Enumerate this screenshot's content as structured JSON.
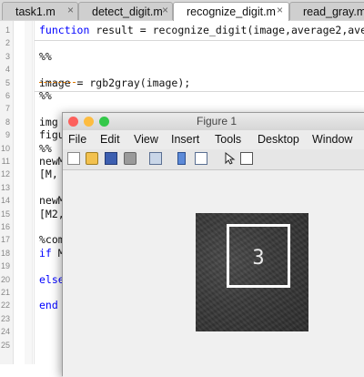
{
  "tabs": [
    {
      "label": "task1.m",
      "active": false
    },
    {
      "label": "detect_digit.m",
      "active": false
    },
    {
      "label": "recognize_digit.m",
      "active": true
    },
    {
      "label": "read_gray.m",
      "active": false
    }
  ],
  "tab_close_glyph": "×",
  "editor": {
    "lines": [
      {
        "num": "1",
        "code": "function result = recognize_digit(image,average2,avera"
      },
      {
        "num": "2",
        "code": ""
      },
      {
        "num": "3",
        "code": "%%"
      },
      {
        "num": "4",
        "code": ""
      },
      {
        "num": "5",
        "code": "image = rgb2gray(image);"
      },
      {
        "num": "6",
        "code": "%%"
      },
      {
        "num": "7",
        "code": ""
      },
      {
        "num": "8",
        "code": "img"
      },
      {
        "num": "9",
        "code": "figu"
      },
      {
        "num": "10",
        "code": "%%"
      },
      {
        "num": "11",
        "code": "newM"
      },
      {
        "num": "12",
        "code": "[M,"
      },
      {
        "num": "13",
        "code": ""
      },
      {
        "num": "14",
        "code": "newM"
      },
      {
        "num": "15",
        "code": "[M2,"
      },
      {
        "num": "16",
        "code": ""
      },
      {
        "num": "17",
        "code": "%com"
      },
      {
        "num": "18",
        "code": "if M"
      },
      {
        "num": "19",
        "code": ""
      },
      {
        "num": "20",
        "code": "else"
      },
      {
        "num": "21",
        "code": ""
      },
      {
        "num": "22",
        "code": "end"
      },
      {
        "num": "23",
        "code": ""
      },
      {
        "num": "24",
        "code": ""
      },
      {
        "num": "25",
        "code": ""
      }
    ]
  },
  "figure": {
    "title": "Figure 1",
    "menu": [
      "File",
      "Edit",
      "View",
      "Insert",
      "Tools",
      "Desktop",
      "Window"
    ],
    "toolbar_icons": [
      "new-figure-icon",
      "open-file-icon",
      "save-icon",
      "print-icon",
      "print-preview-icon",
      "link-plot-icon",
      "insert-legend-icon",
      "pointer-icon",
      "property-inspector-icon"
    ],
    "digit_label": "3",
    "colors": {
      "close": "#fc605c",
      "minimize": "#fdbc40",
      "zoom": "#34c84a"
    }
  }
}
